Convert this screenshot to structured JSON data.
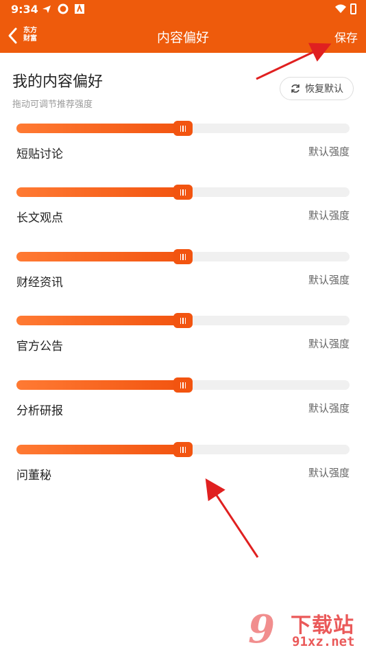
{
  "status": {
    "time": "9:34"
  },
  "nav": {
    "logo": "东方财富",
    "title": "内容偏好",
    "save_label": "保存"
  },
  "heading": "我的内容偏好",
  "subheading": "拖动可调节推荐强度",
  "reset_label": "恢复默认",
  "sliders": [
    {
      "label": "短贴讨论",
      "value_label": "默认强度",
      "level": 0.5
    },
    {
      "label": "长文观点",
      "value_label": "默认强度",
      "level": 0.5
    },
    {
      "label": "财经资讯",
      "value_label": "默认强度",
      "level": 0.5
    },
    {
      "label": "官方公告",
      "value_label": "默认强度",
      "level": 0.5
    },
    {
      "label": "分析研报",
      "value_label": "默认强度",
      "level": 0.5
    },
    {
      "label": "问董秘",
      "value_label": "默认强度",
      "level": 0.5
    }
  ],
  "watermark": {
    "cn": "下载站",
    "url": "91xz.net"
  },
  "colors": {
    "accent": "#ee5b0c",
    "track": "#f0f0f0",
    "annotation": "#e02020"
  }
}
